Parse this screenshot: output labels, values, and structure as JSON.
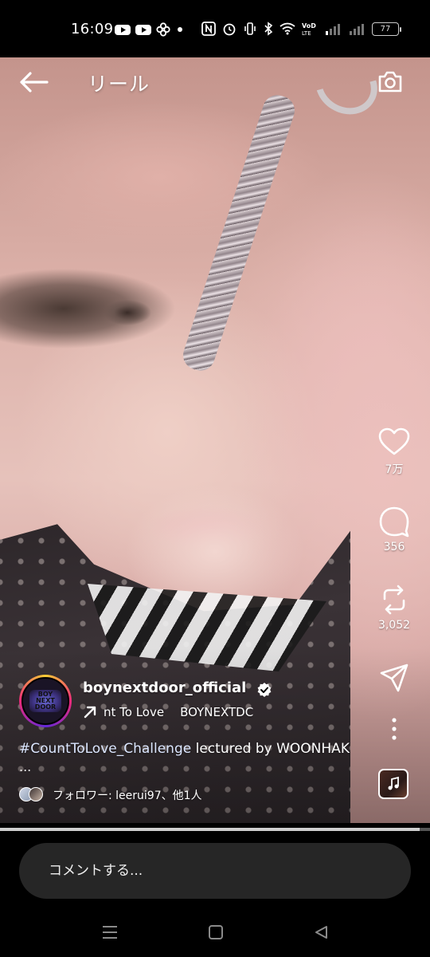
{
  "status_bar": {
    "time": "16:09",
    "network_label": "VoD LTE",
    "battery": "77"
  },
  "header": {
    "title": "リール",
    "back_icon": "arrow-left-icon",
    "camera_icon": "camera-icon"
  },
  "actions": {
    "like_count": "7万",
    "comment_count": "356",
    "repost_count": "3,052",
    "like_icon": "heart-icon",
    "comment_icon": "comment-bubble-icon",
    "repost_icon": "repost-icon",
    "share_icon": "paper-plane-icon",
    "more_icon": "more-vertical-icon"
  },
  "post": {
    "username": "boynextdoor_official",
    "verified": true,
    "audio_title": "nt To Love",
    "audio_artist": "BOYNEXTDC",
    "caption_hashtag": "#CountToLove_Challenge",
    "caption_text": " lectured by WOONHAK",
    "caption_more": "...",
    "followers_text": "フォロワー: leerui97、他1人",
    "avatar_logo_text": "BOY NEXT DOOR"
  },
  "progress": {
    "fraction": 0.975
  },
  "comment": {
    "placeholder": "コメントする..."
  },
  "colors": {
    "accent_ring": [
      "#f9ce34",
      "#ee2a7b",
      "#6228d7"
    ],
    "comment_box": "#262626",
    "background": "#000000"
  }
}
